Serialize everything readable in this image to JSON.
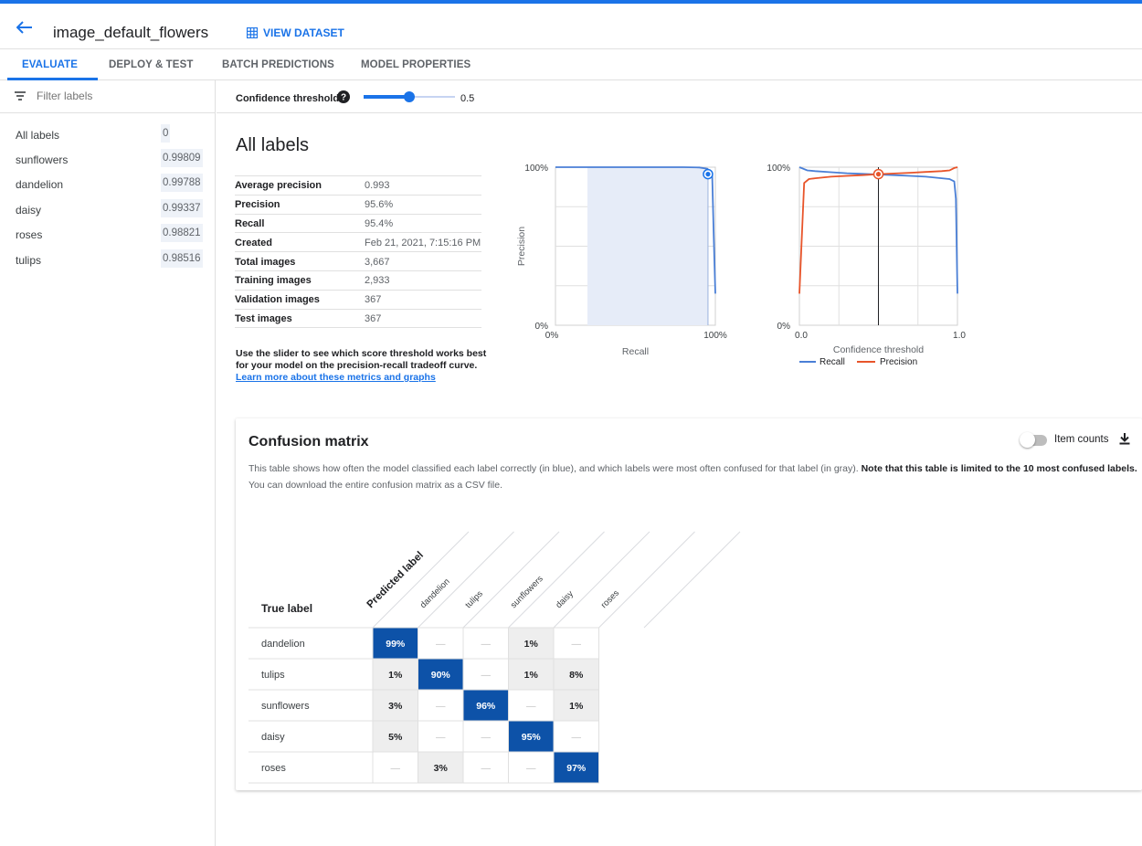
{
  "header": {
    "title": "image_default_flowers",
    "view_dataset": "VIEW DATASET"
  },
  "tabs": [
    {
      "label": "EVALUATE",
      "active": true
    },
    {
      "label": "DEPLOY & TEST",
      "active": false
    },
    {
      "label": "BATCH PREDICTIONS",
      "active": false
    },
    {
      "label": "MODEL PROPERTIES",
      "active": false
    }
  ],
  "sidebar": {
    "filter_placeholder": "Filter labels",
    "labels": [
      {
        "name": "All labels",
        "score": "0"
      },
      {
        "name": "sunflowers",
        "score": "0.99809"
      },
      {
        "name": "dandelion",
        "score": "0.99788"
      },
      {
        "name": "daisy",
        "score": "0.99337"
      },
      {
        "name": "roses",
        "score": "0.98821"
      },
      {
        "name": "tulips",
        "score": "0.98516"
      }
    ]
  },
  "threshold": {
    "label": "Confidence threshold",
    "value": "0.5",
    "fraction": 0.5
  },
  "summary": {
    "title": "All labels",
    "metrics": [
      {
        "key": "Average precision",
        "value": "0.993"
      },
      {
        "key": "Precision",
        "value": "95.6%"
      },
      {
        "key": "Recall",
        "value": "95.4%"
      },
      {
        "key": "Created",
        "value": "Feb 21, 2021, 7:15:16 PM"
      },
      {
        "key": "Total images",
        "value": "3,667"
      },
      {
        "key": "Training images",
        "value": "2,933"
      },
      {
        "key": "Validation images",
        "value": "367"
      },
      {
        "key": "Test images",
        "value": "367"
      }
    ],
    "note_text": "Use the slider to see which score threshold works best for your model on the precision-recall tradeoff curve. ",
    "note_link": "Learn more about these metrics and graphs"
  },
  "chart_data": [
    {
      "type": "area",
      "xlabel": "Recall",
      "ylabel": "Precision",
      "x_ticks": [
        "0%",
        "100%"
      ],
      "y_ticks": [
        "0%",
        "100%"
      ],
      "xlim": [
        0,
        1
      ],
      "ylim": [
        0,
        1
      ],
      "grid": true,
      "series": [
        {
          "x": [
            0.0,
            0.2,
            0.4,
            0.6,
            0.8,
            0.9,
            0.95,
            0.98,
            0.99,
            1.0
          ],
          "y": [
            1.0,
            1.0,
            1.0,
            1.0,
            1.0,
            0.998,
            0.99,
            0.96,
            0.55,
            0.2
          ]
        }
      ],
      "marker": {
        "x": 0.954,
        "y": 0.956
      }
    },
    {
      "type": "line",
      "xlabel": "Confidence threshold",
      "x_ticks": [
        "0.0",
        "1.0"
      ],
      "y_ticks": [
        "0%",
        "100%"
      ],
      "xlim": [
        0,
        1
      ],
      "ylim": [
        0,
        1
      ],
      "grid": true,
      "legend": "bottom",
      "series": [
        {
          "name": "Recall",
          "color": "#4a7fd6",
          "x": [
            0.0,
            0.05,
            0.1,
            0.2,
            0.3,
            0.4,
            0.5,
            0.6,
            0.7,
            0.8,
            0.9,
            0.95,
            0.98,
            0.99,
            1.0
          ],
          "y": [
            1.0,
            0.98,
            0.975,
            0.968,
            0.962,
            0.958,
            0.954,
            0.95,
            0.945,
            0.94,
            0.93,
            0.925,
            0.91,
            0.8,
            0.2
          ]
        },
        {
          "name": "Precision",
          "color": "#e8542a",
          "x": [
            0.0,
            0.03,
            0.06,
            0.1,
            0.2,
            0.3,
            0.4,
            0.5,
            0.6,
            0.7,
            0.8,
            0.9,
            0.95,
            0.98,
            1.0
          ],
          "y": [
            0.2,
            0.9,
            0.925,
            0.93,
            0.94,
            0.945,
            0.95,
            0.956,
            0.96,
            0.965,
            0.97,
            0.975,
            0.98,
            0.995,
            1.0
          ]
        }
      ],
      "threshold": 0.5
    }
  ],
  "confusion": {
    "title": "Confusion matrix",
    "item_counts": "Item counts",
    "desc_plain": "This table shows how often the model classified each label correctly (in blue), and which labels were most often confused for that label (in gray). ",
    "desc_bold": "Note that this table is limited to the 10 most confused labels.",
    "desc_plain2": " You can download the entire confusion matrix as a CSV file.",
    "predicted_label": "Predicted label",
    "true_label": "True label",
    "labels": [
      "dandelion",
      "tulips",
      "sunflowers",
      "daisy",
      "roses"
    ],
    "cells": [
      [
        "99%",
        "—",
        "—",
        "1%",
        "—"
      ],
      [
        "1%",
        "90%",
        "—",
        "1%",
        "8%"
      ],
      [
        "3%",
        "—",
        "96%",
        "—",
        "1%"
      ],
      [
        "5%",
        "—",
        "—",
        "95%",
        "—"
      ],
      [
        "—",
        "3%",
        "—",
        "—",
        "97%"
      ]
    ],
    "colors": {
      "diag": "#0d52a8",
      "off": "#eeeeee"
    }
  }
}
